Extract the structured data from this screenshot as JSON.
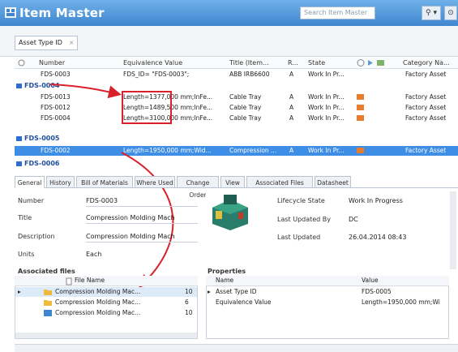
{
  "window": {
    "title": "Item Master",
    "search_placeholder": "Search Item Master",
    "menu_btn": "⚲ ▾",
    "close_glyph": "⊙"
  },
  "filter": {
    "chip_label": "Asset Type ID",
    "chip_close": "×"
  },
  "grid": {
    "columns": [
      "Number",
      "Equivalence Value",
      "Title (Item...",
      "R...",
      "State",
      "Category Na..."
    ],
    "rows": [
      {
        "kind": "row",
        "number": "FDS-0003",
        "equiv": "FDS_ID= \"FDS-0003\";",
        "title": "ABB IRB6600",
        "rev": "A",
        "state": "Work In Pr...",
        "orange": false,
        "category": "Factory Asset"
      },
      {
        "kind": "group",
        "label": "FDS-0004"
      },
      {
        "kind": "row",
        "number": "FDS-0013",
        "equiv": "Length=1377,000 mm;InFe...",
        "title": "Cable Tray",
        "rev": "A",
        "state": "Work In Pr...",
        "orange": true,
        "category": "Factory Asset"
      },
      {
        "kind": "row",
        "number": "FDS-0012",
        "equiv": "Length=1489,500 mm;InFe...",
        "title": "Cable Tray",
        "rev": "A",
        "state": "Work In Pr...",
        "orange": true,
        "category": "Factory Asset"
      },
      {
        "kind": "row",
        "number": "FDS-0004",
        "equiv": "Length=3100,000 mm;InFe...",
        "title": "Cable Tray",
        "rev": "A",
        "state": "Work In Pr...",
        "orange": true,
        "category": "Factory Asset"
      },
      {
        "kind": "group",
        "label": "FDS-0005"
      },
      {
        "kind": "selected",
        "number": "FDS-0002",
        "equiv": "Length=1950,000 mm;Wid...",
        "title": "Compression ...",
        "rev": "A",
        "state": "Work In Pr...",
        "orange": true,
        "category": "Factory Asset"
      },
      {
        "kind": "group",
        "label": "FDS-0006"
      }
    ]
  },
  "tabs": [
    "General",
    "History",
    "Bill of Materials",
    "Where Used",
    "Change Order",
    "View",
    "Associated Files",
    "Datasheet"
  ],
  "general": {
    "fields": [
      {
        "label": "Number",
        "value": "FDS-0003"
      },
      {
        "label": "Title",
        "value": "Compression Molding Mach"
      },
      {
        "label": "Description",
        "value": "Compression Molding Mach"
      },
      {
        "label": "Units",
        "value": "Each"
      }
    ],
    "status": [
      {
        "label": "Lifecycle State",
        "value": "Work In Progress"
      },
      {
        "label": "Last Updated By",
        "value": "DC"
      },
      {
        "label": "Last Updated",
        "value": "26.04.2014 08:43"
      }
    ]
  },
  "assoc": {
    "title": "Associated files",
    "col_name": "File Name",
    "files": [
      {
        "name": "Compression Molding Mac...",
        "num": "10"
      },
      {
        "name": "Compression Molding Mac...",
        "num": "6"
      },
      {
        "name": "Compression Molding Mac...",
        "num": "10"
      }
    ]
  },
  "properties": {
    "title": "Properties",
    "col_name": "Name",
    "col_value": "Value",
    "rows": [
      {
        "name": "Asset Type ID",
        "value": "FDS-0005"
      },
      {
        "name": "Equivalence Value",
        "value": "Length=1950,000 mm;Wi"
      }
    ]
  },
  "colors": {
    "title_bar": "#4a90d9",
    "selection": "#3e8ee6",
    "group_text": "#1e4f9c",
    "state_orange": "#e67c2c",
    "callout_red": "#d9202b"
  }
}
